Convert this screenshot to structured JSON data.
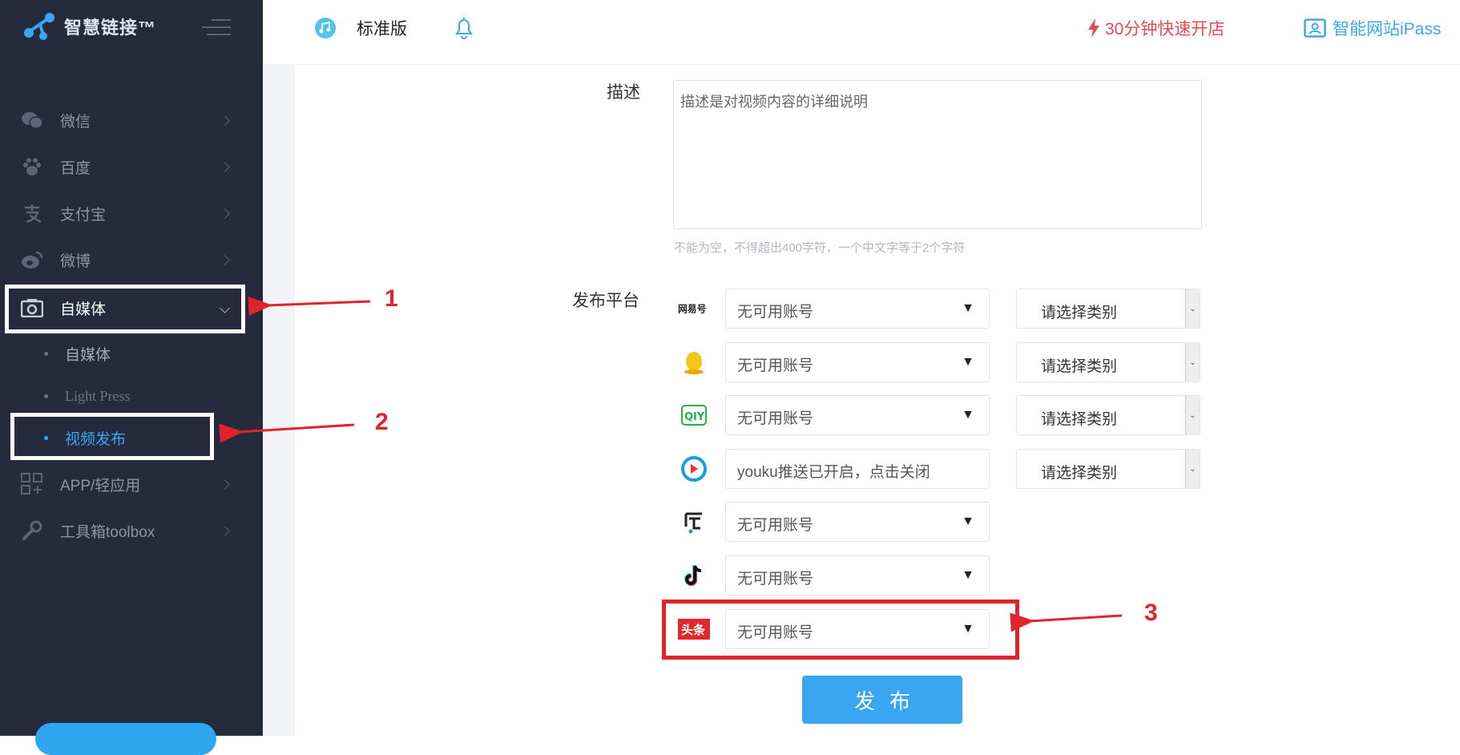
{
  "brand": {
    "title": "智慧链接™"
  },
  "sidebar": {
    "items": [
      {
        "label": "微信",
        "icon": "wechat-icon"
      },
      {
        "label": "百度",
        "icon": "paw-icon"
      },
      {
        "label": "支付宝",
        "icon": "alipay-icon"
      },
      {
        "label": "微博",
        "icon": "weibo-icon"
      },
      {
        "label": "自媒体",
        "icon": "media-icon"
      },
      {
        "label": "APP/轻应用",
        "icon": "apps-icon"
      },
      {
        "label": "工具箱toolbox",
        "icon": "wrench-icon"
      }
    ],
    "sub_items": [
      {
        "label": "自媒体"
      },
      {
        "label": "Light Press"
      },
      {
        "label": "视频发布"
      }
    ]
  },
  "header": {
    "edition": "标准版",
    "quick_open": "30分钟快速开店",
    "ipass": "智能网站iPass"
  },
  "form": {
    "desc_label": "描述",
    "desc_text": "描述是对视频内容的详细说明",
    "desc_hint": "不能为空，不得超出400字符，一个中文字等于2个字符",
    "platform_label": "发布平台",
    "platforms": [
      {
        "name": "网易号",
        "account": "无可用账号",
        "category": "请选择类别"
      },
      {
        "name": "QQ",
        "account": "无可用账号",
        "category": "请选择类别"
      },
      {
        "name": "爱奇艺",
        "account": "无可用账号",
        "category": "请选择类别"
      },
      {
        "name": "优酷",
        "account": "youku推送已开启，点击关闭",
        "category": "请选择类别"
      },
      {
        "name": "百家号",
        "account": "无可用账号"
      },
      {
        "name": "抖音",
        "account": "无可用账号"
      },
      {
        "name": "头条",
        "account": "无可用账号"
      }
    ],
    "caret": "▼",
    "publish": "发布"
  },
  "annotations": {
    "n1": "1",
    "n2": "2",
    "n3": "3"
  },
  "colors": {
    "sidebar_bg": "#252a3c",
    "accent": "#3aa6f2",
    "annotation_red": "#e0242b"
  }
}
